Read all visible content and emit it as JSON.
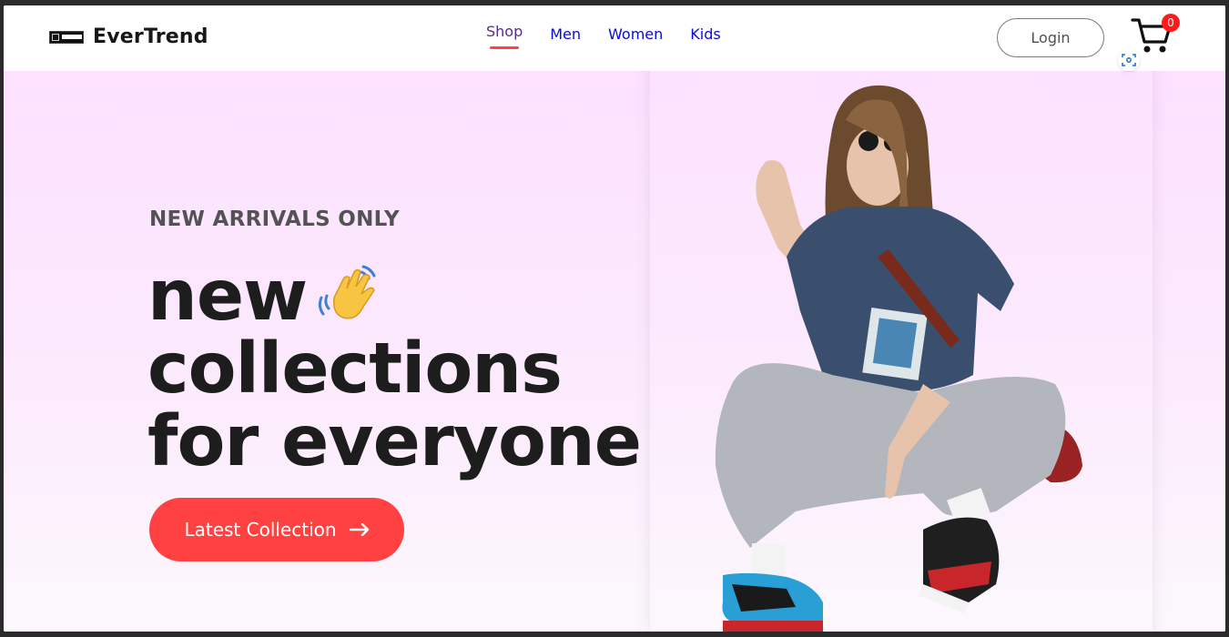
{
  "brand": {
    "name": "EverTrend"
  },
  "nav": {
    "items": [
      {
        "label": "Shop",
        "active": true
      },
      {
        "label": "Men",
        "active": false
      },
      {
        "label": "Women",
        "active": false
      },
      {
        "label": "Kids",
        "active": false
      }
    ]
  },
  "header": {
    "login_label": "Login",
    "cart_count": "0"
  },
  "hero": {
    "label": "NEW ARRIVALS ONLY",
    "title_line1": "new",
    "title_line2": "collections",
    "title_line3": "for everyone",
    "cta_label": "Latest Collection"
  },
  "colors": {
    "accent": "#ff4141",
    "nav_link": "#0a0ad6",
    "nav_active": "#5a2c8a",
    "hero_bg_top": "#fde1ff",
    "hero_bg_bottom": "#fcf8fd",
    "badge": "#ff1b1b"
  },
  "icons": {
    "cart": "cart-icon",
    "wave": "waving-hand-icon",
    "arrow": "arrow-right-icon",
    "scan": "scan-icon"
  }
}
